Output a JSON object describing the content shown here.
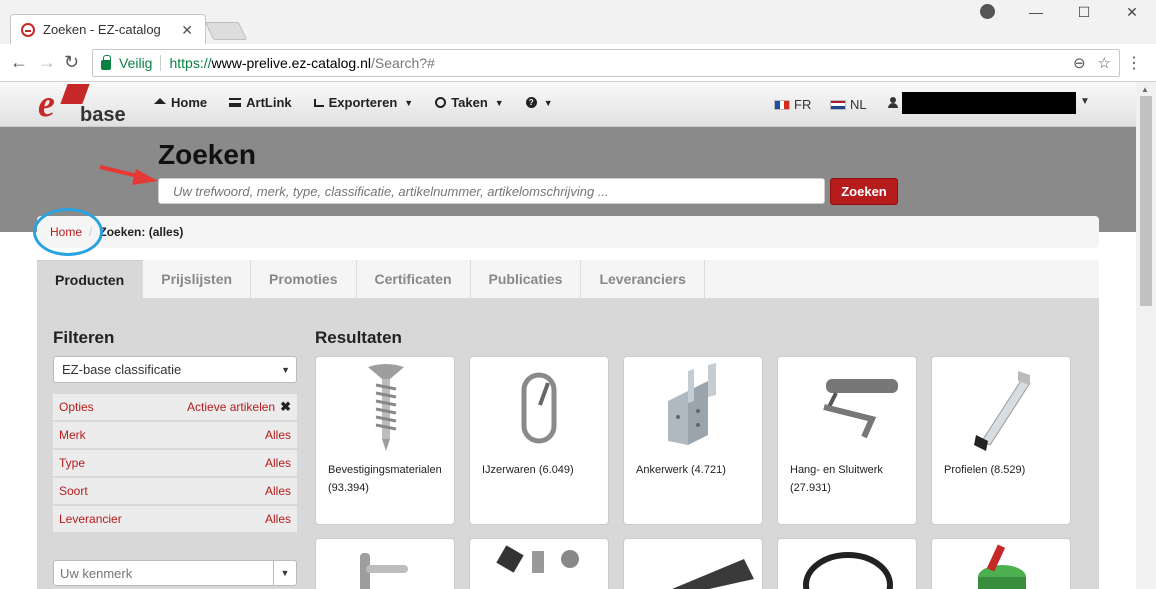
{
  "browser": {
    "tab_title": "Zoeken - EZ-catalog",
    "tab_close": "✕",
    "secure_label": "Veilig",
    "url_scheme": "https://",
    "url_host": "www-prelive.ez-catalog.nl",
    "url_path": "/Search?#"
  },
  "nav": {
    "home": "Home",
    "artlink": "ArtLink",
    "exporteren": "Exporteren",
    "taken": "Taken",
    "lang_fr": "FR",
    "lang_nl": "NL"
  },
  "logo": {
    "text": "base"
  },
  "hero": {
    "title": "Zoeken",
    "search_placeholder": "Uw trefwoord, merk, type, classificatie, artikelnummer, artikelomschrijving ...",
    "search_button": "Zoeken"
  },
  "breadcrumb": {
    "home": "Home",
    "separator": "/",
    "current": "Zoeken: (alles)"
  },
  "tabs": [
    "Producten",
    "Prijslijsten",
    "Promoties",
    "Certificaten",
    "Publicaties",
    "Leveranciers"
  ],
  "filters": {
    "title": "Filteren",
    "classification": "EZ-base classificatie",
    "rows": [
      {
        "label": "Opties",
        "value": "Actieve artikelen"
      },
      {
        "label": "Merk",
        "value": "Alles"
      },
      {
        "label": "Type",
        "value": "Alles"
      },
      {
        "label": "Soort",
        "value": "Alles"
      },
      {
        "label": "Leverancier",
        "value": "Alles"
      }
    ],
    "kenmerk_placeholder": "Uw kenmerk"
  },
  "results": {
    "title": "Resultaten",
    "items": [
      {
        "label": "Bevestigingsmaterialen (93.394)",
        "icon": "screw-icon"
      },
      {
        "label": "IJzerwaren (6.049)",
        "icon": "carabiner-icon"
      },
      {
        "label": "Ankerwerk (4.721)",
        "icon": "bracket-icon"
      },
      {
        "label": "Hang- en Sluitwerk (27.931)",
        "icon": "door-closer-icon"
      },
      {
        "label": "Profielen (8.529)",
        "icon": "profile-icon"
      }
    ]
  },
  "colors": {
    "brand_red": "#b71c1c",
    "hero_gray": "#8a8a8a",
    "annotation_blue": "#29a3e0"
  }
}
